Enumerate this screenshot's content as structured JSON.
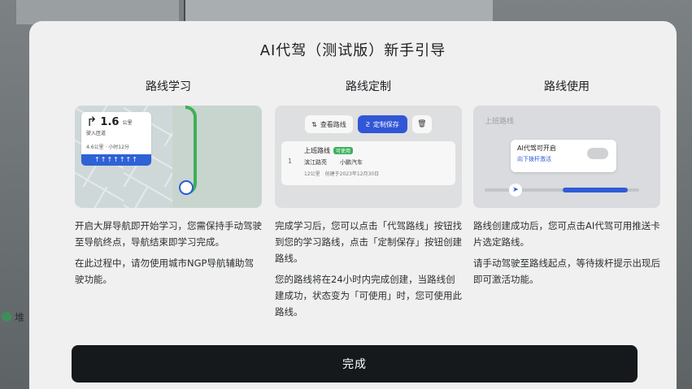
{
  "background": {
    "side_label": "堆"
  },
  "modal": {
    "title": "AI代驾（测试版）新手引导",
    "done_label": "完成"
  },
  "columns": [
    {
      "title": "路线学习",
      "paragraphs": [
        "开启大屏导航即开始学习，您需保持手动驾驶至导航终点，导航结束即学习完成。",
        "在此过程中，请勿使用城市NGP导航辅助驾驶功能。"
      ],
      "illustration": {
        "distance": "1.6",
        "distance_unit": "公里",
        "road": "驶入匝道",
        "eta": "4.6公里 · 小时12分",
        "lanes": "↑↑↑↑↑↑↑"
      }
    },
    {
      "title": "路线定制",
      "paragraphs": [
        "完成学习后，您可以点击「代驾路线」按钮找到您的学习路线，点击「定制保存」按钮创建路线。",
        "您的路线将在24小时内完成创建，当路线创建成功，状态变为「可使用」时，您可使用此路线。"
      ],
      "illustration": {
        "view_route_label": "查看路线",
        "save_label": "定制保存",
        "delete_icon": "trash-icon",
        "route_index": "1",
        "route_name": "上班路线",
        "route_tag": "可使用",
        "start": "滨江路亮",
        "end": "小鹏汽车",
        "length": "12公里",
        "created": "创建于2023年12月30日"
      }
    },
    {
      "title": "路线使用",
      "paragraphs": [
        "路线创建成功后，您可点击AI代驾可用推送卡片选定路线。",
        "请手动驾驶至路线起点，等待拨杆提示出现后即可激活功能。"
      ],
      "illustration": {
        "route_label": "上班路线",
        "push_title": "AI代驾可开启",
        "push_sub": "向下拨杆激活",
        "progress": 0.4
      }
    }
  ]
}
